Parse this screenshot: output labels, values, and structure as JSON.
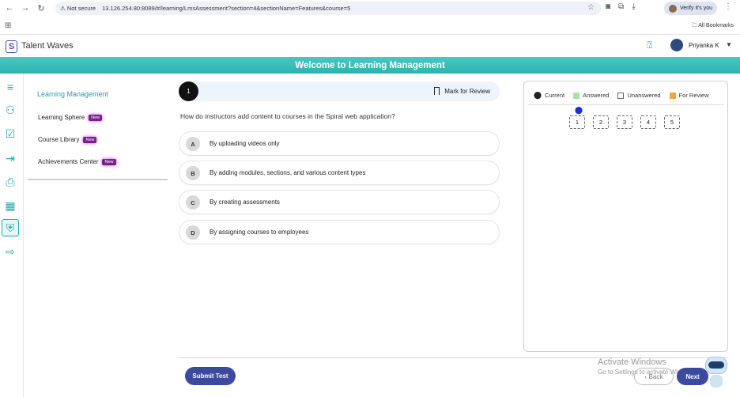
{
  "browser": {
    "not_secure": "Not secure",
    "url": "13.126.254.80:8089/#/learning/LmsAssessment?section=4&sectionName=Features&course=5",
    "verify": "Verify it's you",
    "all_bookmarks": "All Bookmarks"
  },
  "header": {
    "brand": "Talent Waves",
    "user": "Priyanka K"
  },
  "banner": "Welcome to Learning Management",
  "sidebar": {
    "title": "Learning Management",
    "items": [
      {
        "label": "Learning Sphere",
        "badge": "New"
      },
      {
        "label": "Course Library",
        "badge": "New"
      },
      {
        "label": "Achievements Center",
        "badge": "New"
      }
    ]
  },
  "question": {
    "number": "1",
    "mark_review": "Mark for Review",
    "text": "How do instructors add content to courses in the Spiral web application?",
    "options": [
      {
        "letter": "A",
        "text": "By uploading videos only"
      },
      {
        "letter": "B",
        "text": "By adding modules, sections, and various content types"
      },
      {
        "letter": "C",
        "text": "By creating assessments"
      },
      {
        "letter": "D",
        "text": "By assigning courses to employees"
      }
    ]
  },
  "palette": {
    "legend": [
      {
        "label": "Current",
        "color": "#222222"
      },
      {
        "label": "Answered",
        "color": "#a6e3a1"
      },
      {
        "label": "Unanswered",
        "color": "#ffffff"
      },
      {
        "label": "For Review",
        "color": "#f7a23b"
      }
    ],
    "questions": [
      "1",
      "2",
      "3",
      "4",
      "5"
    ]
  },
  "footer": {
    "submit": "Submit Test",
    "back": "Back",
    "next": "Next"
  },
  "watermark": {
    "line1": "Activate Windows",
    "line2": "Go to Settings to activate Windows."
  }
}
